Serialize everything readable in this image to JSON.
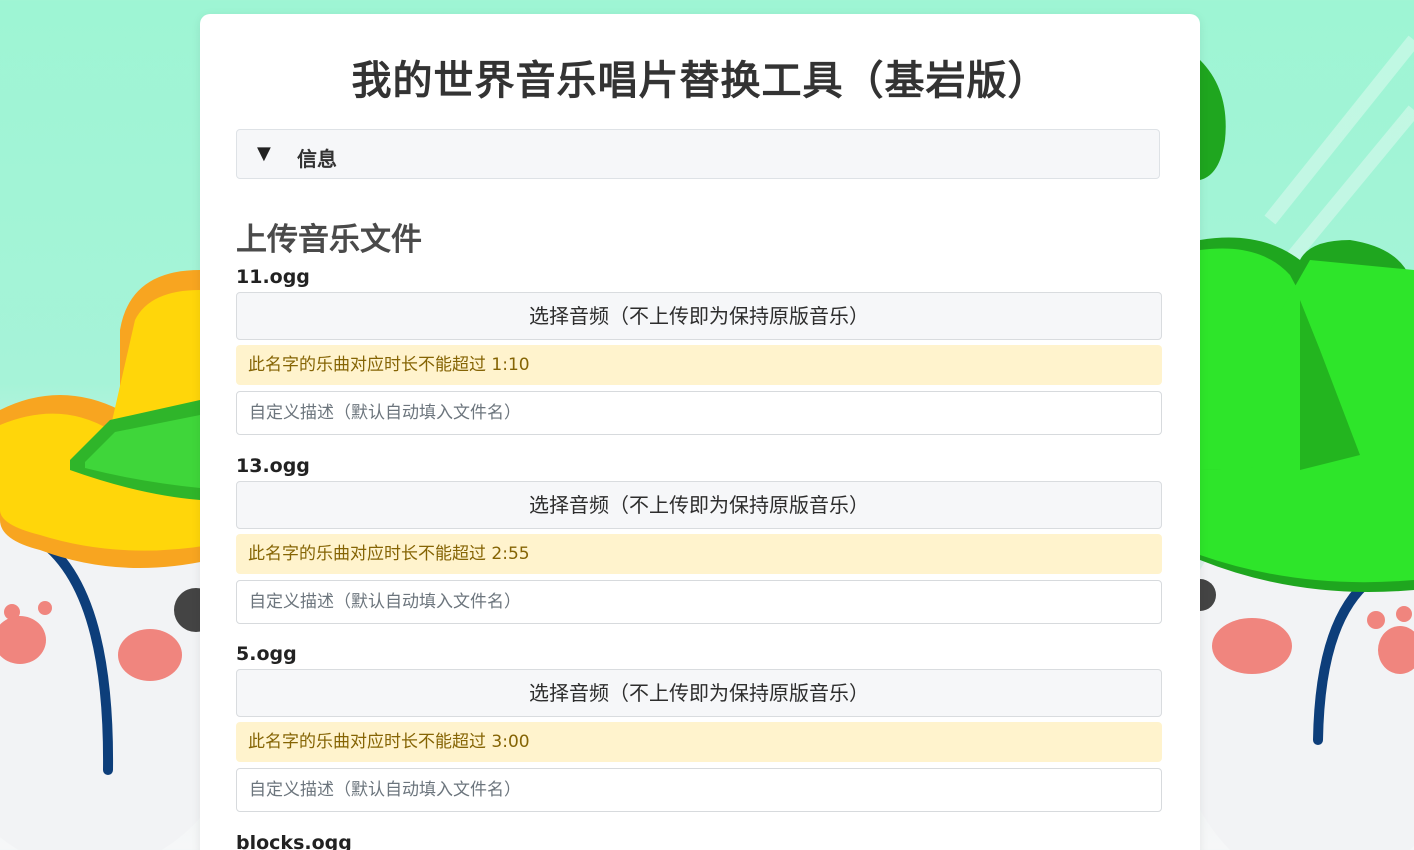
{
  "page": {
    "title": "我的世界音乐唱片替换工具（基岩版）"
  },
  "info": {
    "arrow": "▼",
    "label": "信息"
  },
  "upload_section": {
    "heading": "上传音乐文件",
    "tracks": [
      {
        "name": "11.ogg",
        "button_label": "选择音频（不上传即为保持原版音乐）",
        "warning": "此名字的乐曲对应时长不能超过 1:10",
        "placeholder": "自定义描述（默认自动填入文件名）"
      },
      {
        "name": "13.ogg",
        "button_label": "选择音频（不上传即为保持原版音乐）",
        "warning": "此名字的乐曲对应时长不能超过 2:55",
        "placeholder": "自定义描述（默认自动填入文件名）"
      },
      {
        "name": "5.ogg",
        "button_label": "选择音频（不上传即为保持原版音乐）",
        "warning": "此名字的乐曲对应时长不能超过 3:00",
        "placeholder": "自定义描述（默认自动填入文件名）"
      },
      {
        "name": "blocks.ogg"
      }
    ]
  },
  "colors": {
    "background_top": "#9ef5d4",
    "warning_bg": "#fff3cd",
    "warning_text": "#856404",
    "button_bg": "#f6f7f9"
  }
}
